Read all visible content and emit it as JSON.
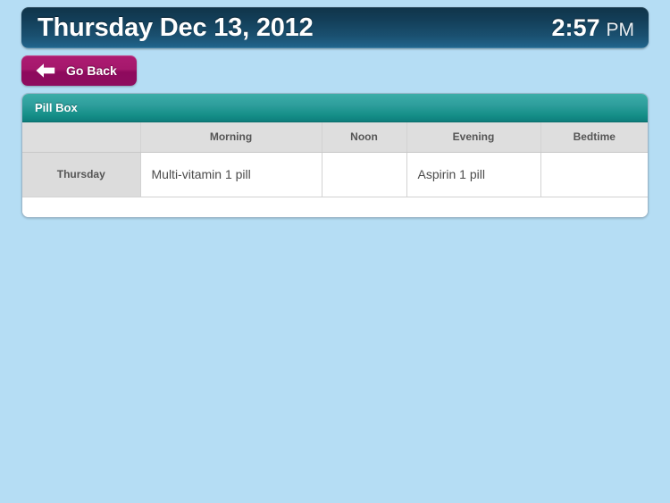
{
  "titlebar": {
    "date": "Thursday Dec 13, 2012",
    "time": "2:57",
    "meridiem": "PM"
  },
  "toolbar": {
    "go_back_label": "Go Back",
    "go_back_icon": "arrow-left-icon"
  },
  "card": {
    "title": "Pill Box",
    "table": {
      "columns": [
        "",
        "Morning",
        "Noon",
        "Evening",
        "Bedtime"
      ],
      "rows": [
        {
          "day": "Thursday",
          "morning": "Multi-vitamin 1 pill",
          "noon": "",
          "evening": "Aspirin 1 pill",
          "bedtime": ""
        }
      ]
    }
  },
  "colors": {
    "background": "#b5ddf4",
    "titlebar_top": "#103449",
    "titlebar_bottom": "#20638a",
    "go_back": "#a5186c",
    "card_header_top": "#3cada8",
    "card_header_bottom": "#0d7e7c",
    "table_header": "#dedede",
    "day_cell": "#dcdcdc"
  }
}
